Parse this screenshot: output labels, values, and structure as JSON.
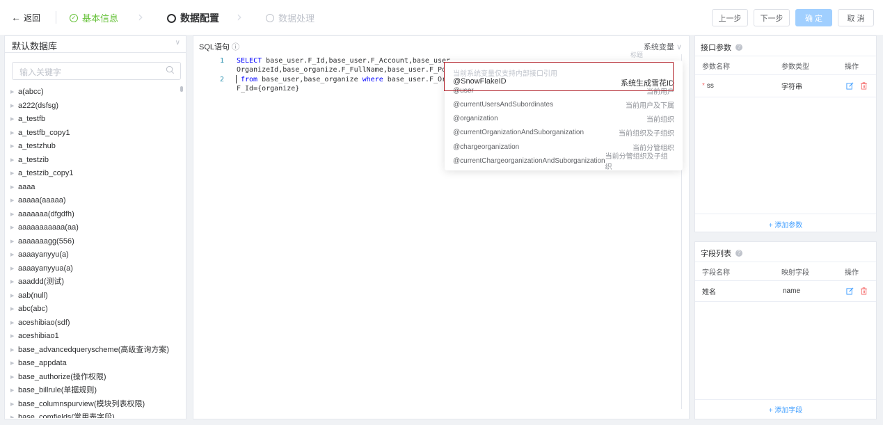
{
  "topbar": {
    "back_label": "返回",
    "steps": [
      {
        "label": "基本信息",
        "state": "done"
      },
      {
        "label": "数据配置",
        "state": "active"
      },
      {
        "label": "数据处理",
        "state": "todo"
      }
    ],
    "buttons": {
      "prev": "上一步",
      "next": "下一步",
      "confirm": "确 定",
      "cancel": "取 消"
    }
  },
  "left": {
    "db_select": "默认数据库",
    "search_placeholder": "输入关键字",
    "tables": [
      "a(abcc)",
      "a222(dsfsg)",
      "a_testfb",
      "a_testfb_copy1",
      "a_testzhub",
      "a_testzib",
      "a_testzib_copy1",
      "aaaa",
      "aaaaa(aaaaa)",
      "aaaaaaa(dfgdfh)",
      "aaaaaaaaaaa(aa)",
      "aaaaaaagg(556)",
      "aaaayanyyu(a)",
      "aaaayanyyua(a)",
      "aaaddd(测试)",
      "aab(null)",
      "abc(abc)",
      "aceshibiao(sdf)",
      "aceshibiao1",
      "base_advancedqueryscheme(高级查询方案)",
      "base_appdata",
      "base_authorize(操作权限)",
      "base_billrule(单据规则)",
      "base_columnspurview(模块列表权限)",
      "base_comfields(常用表字段)"
    ]
  },
  "sql": {
    "title": "SQL语句",
    "sys_var_label": "系统变量",
    "ghost_label": "标题",
    "line1_no": "1",
    "line2_no": "2",
    "line1a_kw": "SELECT",
    "line1a_rest": " base_user.F_Id,base_user.F_Account,base_user",
    "line1b": "OrganizeId,base_organize.F_FullName,base_user.F_Pos",
    "line2a_kw": "from",
    "line2a_mid": " base_user,base_organize ",
    "line2a_kw2": "where",
    "line2a_rest": " base_user.F_Org",
    "line2b": "F_Id={organize}"
  },
  "popup": {
    "hint": "当前系统变量仅支持内部接口引用",
    "selected": {
      "name": "@SnowFlakeID",
      "desc": "系统生成雪花ID"
    },
    "items": [
      {
        "name": "@user",
        "desc": "当前用户"
      },
      {
        "name": "@currentUsersAndSubordinates",
        "desc": "当前用户及下属"
      },
      {
        "name": "@organization",
        "desc": "当前组织"
      },
      {
        "name": "@currentOrganizationAndSuborganization",
        "desc": "当前组织及子组织"
      },
      {
        "name": "@chargeorganization",
        "desc": "当前分管组织"
      },
      {
        "name": "@currentChargeorganizationAndSuborganization",
        "desc": "当前分管组织及子组织"
      }
    ]
  },
  "params": {
    "title": "接口参数",
    "headers": {
      "name": "参数名称",
      "type": "参数类型",
      "action": "操作"
    },
    "row": {
      "name": "ss",
      "type": "字符串"
    },
    "add_label": "+ 添加参数"
  },
  "fields": {
    "title": "字段列表",
    "headers": {
      "name": "字段名称",
      "map": "映射字段",
      "action": "操作"
    },
    "row": {
      "name": "姓名",
      "map": "name"
    },
    "add_label": "+ 添加字段"
  },
  "colors": {
    "primary": "#409eff",
    "success": "#67c23a",
    "danger": "#f56c6c",
    "highlight_border": "#b3262e"
  }
}
